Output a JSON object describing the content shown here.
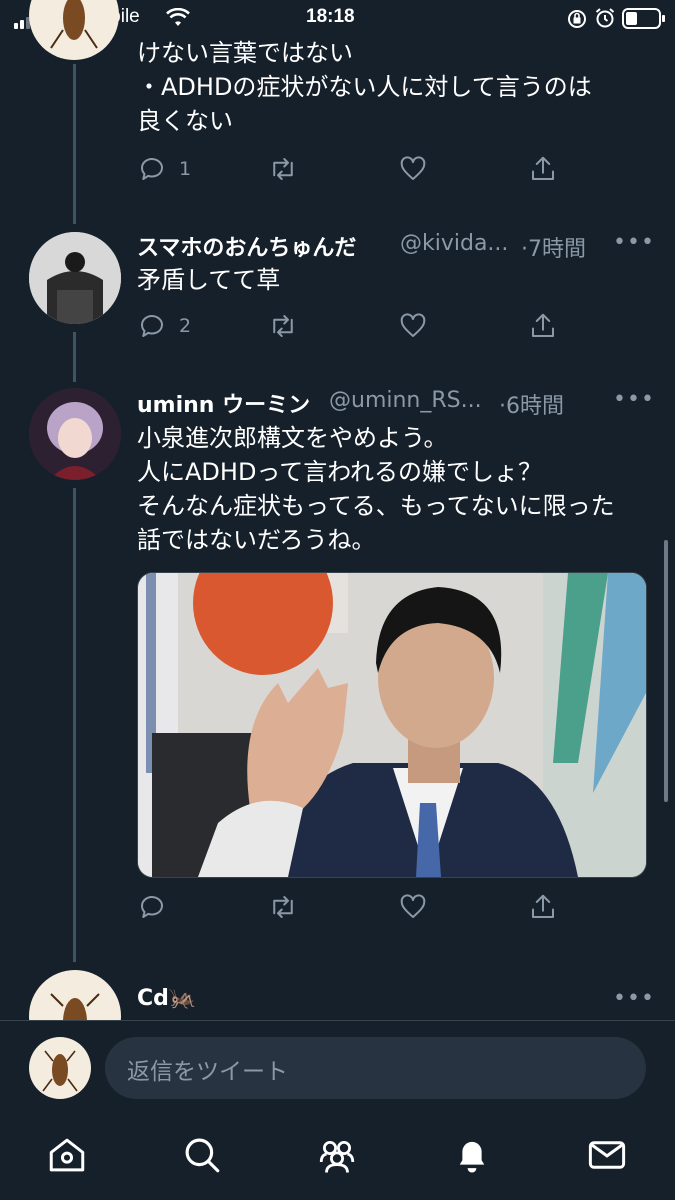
{
  "status_bar": {
    "carrier": "UQ mobile",
    "time": "18:18"
  },
  "tweets": [
    {
      "text_lines": [
        "けない言葉ではない",
        "・ADHDの症状がない人に対して言うのは",
        "良くない"
      ],
      "actions": {
        "reply_count": "1"
      }
    },
    {
      "name": "スマホのおんちゅんだ",
      "handle": "@kivida...",
      "time": "·7時間",
      "text_lines": [
        "矛盾してて草"
      ],
      "actions": {
        "reply_count": "2"
      }
    },
    {
      "name": "uminn ウーミン",
      "handle": "@uminn_RS...",
      "time": "·6時間",
      "text_lines": [
        "小泉進次郎構文をやめよう。",
        "人にADHDって言われるの嫌でしょ？",
        "そんなん症状もってる、もってないに限った",
        "話ではないだろうね。"
      ],
      "actions": {
        "reply_count": ""
      }
    },
    {
      "name": "Cd🦗"
    }
  ],
  "reply_bar": {
    "placeholder": "返信をツイート"
  },
  "more_label": "•••",
  "icons": {
    "reply": "reply-icon",
    "retweet": "retweet-icon",
    "like": "like-icon",
    "share": "share-icon",
    "nav": [
      "home-icon",
      "search-icon",
      "communities-icon",
      "notifications-icon",
      "messages-icon"
    ]
  },
  "colors": {
    "background": "#15202b",
    "secondary_text": "#8b98a5",
    "thread_line": "#3d5466",
    "reply_box": "#273340"
  }
}
